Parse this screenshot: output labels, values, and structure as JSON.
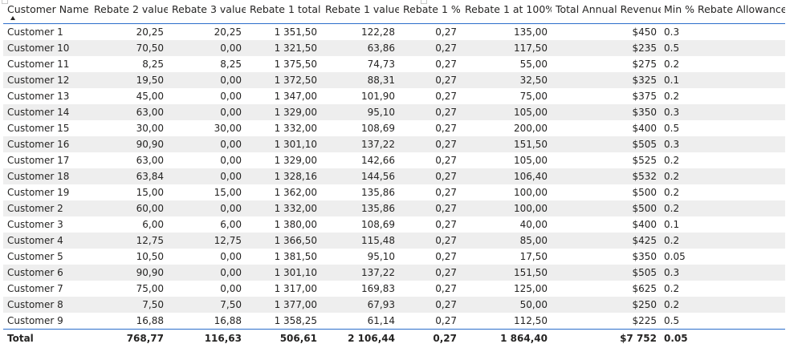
{
  "table": {
    "headers": [
      "Customer Name",
      "Rebate 2 value",
      "Rebate 3 value",
      "Rebate 1 total",
      "Rebate 1 value",
      "Rebate 1 %",
      "Rebate 1 at 100%",
      "Total Annual Revenue",
      "Min % Rebate Allowance"
    ],
    "rows": [
      [
        "Customer 1",
        "20,25",
        "20,25",
        "1 351,50",
        "122,28",
        "0,27",
        "135,00",
        "$450",
        "0.3"
      ],
      [
        "Customer 10",
        "70,50",
        "0,00",
        "1 321,50",
        "63,86",
        "0,27",
        "117,50",
        "$235",
        "0.5"
      ],
      [
        "Customer 11",
        "8,25",
        "8,25",
        "1 375,50",
        "74,73",
        "0,27",
        "55,00",
        "$275",
        "0.2"
      ],
      [
        "Customer 12",
        "19,50",
        "0,00",
        "1 372,50",
        "88,31",
        "0,27",
        "32,50",
        "$325",
        "0.1"
      ],
      [
        "Customer 13",
        "45,00",
        "0,00",
        "1 347,00",
        "101,90",
        "0,27",
        "75,00",
        "$375",
        "0.2"
      ],
      [
        "Customer 14",
        "63,00",
        "0,00",
        "1 329,00",
        "95,10",
        "0,27",
        "105,00",
        "$350",
        "0.3"
      ],
      [
        "Customer 15",
        "30,00",
        "30,00",
        "1 332,00",
        "108,69",
        "0,27",
        "200,00",
        "$400",
        "0.5"
      ],
      [
        "Customer 16",
        "90,90",
        "0,00",
        "1 301,10",
        "137,22",
        "0,27",
        "151,50",
        "$505",
        "0.3"
      ],
      [
        "Customer 17",
        "63,00",
        "0,00",
        "1 329,00",
        "142,66",
        "0,27",
        "105,00",
        "$525",
        "0.2"
      ],
      [
        "Customer 18",
        "63,84",
        "0,00",
        "1 328,16",
        "144,56",
        "0,27",
        "106,40",
        "$532",
        "0.2"
      ],
      [
        "Customer 19",
        "15,00",
        "15,00",
        "1 362,00",
        "135,86",
        "0,27",
        "100,00",
        "$500",
        "0.2"
      ],
      [
        "Customer 2",
        "60,00",
        "0,00",
        "1 332,00",
        "135,86",
        "0,27",
        "100,00",
        "$500",
        "0.2"
      ],
      [
        "Customer 3",
        "6,00",
        "6,00",
        "1 380,00",
        "108,69",
        "0,27",
        "40,00",
        "$400",
        "0.1"
      ],
      [
        "Customer 4",
        "12,75",
        "12,75",
        "1 366,50",
        "115,48",
        "0,27",
        "85,00",
        "$425",
        "0.2"
      ],
      [
        "Customer 5",
        "10,50",
        "0,00",
        "1 381,50",
        "95,10",
        "0,27",
        "17,50",
        "$350",
        "0.05"
      ],
      [
        "Customer 6",
        "90,90",
        "0,00",
        "1 301,10",
        "137,22",
        "0,27",
        "151,50",
        "$505",
        "0.3"
      ],
      [
        "Customer 7",
        "75,00",
        "0,00",
        "1 317,00",
        "169,83",
        "0,27",
        "125,00",
        "$625",
        "0.2"
      ],
      [
        "Customer 8",
        "7,50",
        "7,50",
        "1 377,00",
        "67,93",
        "0,27",
        "50,00",
        "$250",
        "0.2"
      ],
      [
        "Customer 9",
        "16,88",
        "16,88",
        "1 358,25",
        "61,14",
        "0,27",
        "112,50",
        "$225",
        "0.5"
      ]
    ],
    "total": [
      "Total",
      "768,77",
      "116,63",
      "506,61",
      "2 106,44",
      "0,27",
      "1 864,40",
      "$7 752",
      "0.05"
    ]
  },
  "icons": {
    "sort": "sort-ascending-icon"
  }
}
